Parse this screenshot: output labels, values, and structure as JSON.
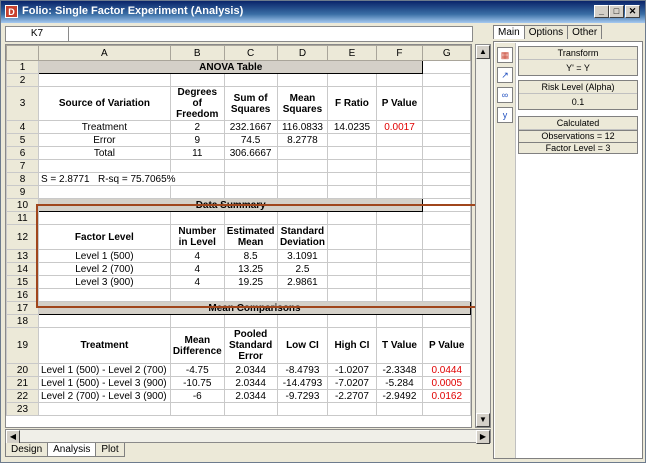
{
  "window": {
    "title": "Folio: Single Factor Experiment (Analysis)",
    "icon_letter": "D"
  },
  "formula_bar": {
    "cell_ref": "K7",
    "value": ""
  },
  "columns": [
    "A",
    "B",
    "C",
    "D",
    "E",
    "F",
    "G"
  ],
  "anova": {
    "title": "ANOVA Table",
    "headers": [
      "Source of Variation",
      "Degrees of Freedom",
      "Sum of Squares",
      "Mean Squares",
      "F Ratio",
      "P Value"
    ],
    "rows": [
      [
        "Treatment",
        "2",
        "232.1667",
        "116.0833",
        "14.0235",
        "0.0017"
      ],
      [
        "Error",
        "9",
        "74.5",
        "8.2778",
        "",
        ""
      ],
      [
        "Total",
        "11",
        "306.6667",
        "",
        "",
        ""
      ]
    ]
  },
  "fit_stats": {
    "s": "S = 2.8771",
    "rsq": "R-sq = 75.7065%"
  },
  "data_summary": {
    "title": "Data Summary",
    "headers": [
      "Factor Level",
      "Number in Level",
      "Estimated Mean",
      "Standard Deviation"
    ],
    "rows": [
      [
        "Level 1 (500)",
        "4",
        "8.5",
        "3.1091"
      ],
      [
        "Level 2 (700)",
        "4",
        "13.25",
        "2.5"
      ],
      [
        "Level 3 (900)",
        "4",
        "19.25",
        "2.9861"
      ]
    ]
  },
  "mean_comparisons": {
    "title": "Mean Comparisons",
    "headers": [
      "Treatment",
      "Mean Difference",
      "Pooled Standard Error",
      "Low CI",
      "High CI",
      "T Value",
      "P Value"
    ],
    "rows": [
      [
        "Level 1 (500) - Level 2 (700)",
        "-4.75",
        "2.0344",
        "-8.4793",
        "-1.0207",
        "-2.3348",
        "0.0444"
      ],
      [
        "Level 1 (500) - Level 3 (900)",
        "-10.75",
        "2.0344",
        "-14.4793",
        "-7.0207",
        "-5.284",
        "0.0005"
      ],
      [
        "Level 2 (700) - Level 3 (900)",
        "-6",
        "2.0344",
        "-9.7293",
        "-2.2707",
        "-2.9492",
        "0.0162"
      ]
    ]
  },
  "sheet_tabs": [
    "Design",
    "Analysis",
    "Plot"
  ],
  "right_panel": {
    "tabs": [
      "Main",
      "Options",
      "Other"
    ],
    "transform_label": "Transform",
    "transform_value": "Y' = Y",
    "risk_label": "Risk Level (Alpha)",
    "risk_value": "0.1",
    "calc_label": "Calculated",
    "observations": "Observations = 12",
    "factor_level": "Factor Level = 3"
  },
  "colors": {
    "p_value_significant": "#e00000",
    "highlight_border": "#a0461c"
  }
}
